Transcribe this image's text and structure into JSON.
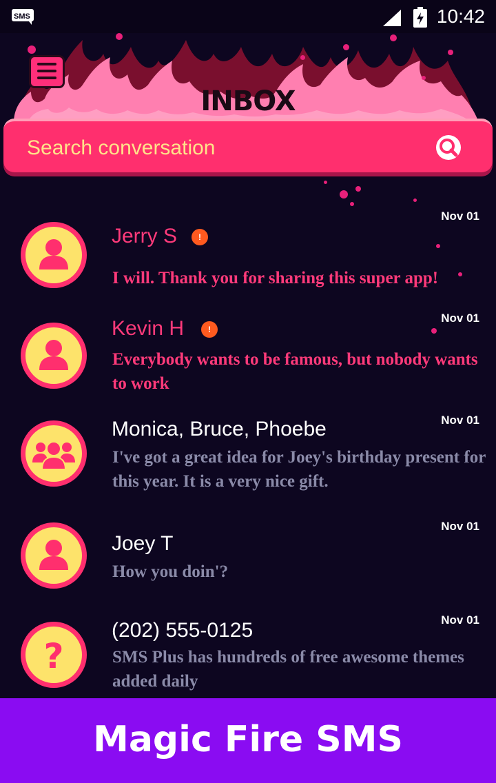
{
  "status_bar": {
    "time": "10:42",
    "app_icon": "sms-plus-icon",
    "signal_icon": "signal-icon",
    "battery_icon": "battery-charging-icon"
  },
  "header": {
    "title": "INBOX",
    "menu_icon": "hamburger-menu-icon"
  },
  "search": {
    "placeholder": "Search conversation",
    "icon": "search-icon"
  },
  "conversations": [
    {
      "name": "Jerry S",
      "snippet": "I will. Thank you for sharing this super app!",
      "date": "Nov 01",
      "unread": true,
      "badge": "!",
      "avatar": "person-icon"
    },
    {
      "name": "Kevin H",
      "snippet": "Everybody wants to be famous, but nobody wants to work",
      "date": "Nov 01",
      "unread": true,
      "badge": "!",
      "avatar": "person-icon"
    },
    {
      "name": "Monica, Bruce, Phoebe",
      "snippet": "I've got a great idea for Joey's birthday present for this year. It is a very nice gift.",
      "date": "Nov 01",
      "unread": false,
      "avatar": "group-icon"
    },
    {
      "name": "Joey T",
      "snippet": "How you doin'?",
      "date": "Nov 01",
      "unread": false,
      "avatar": "person-icon"
    },
    {
      "name": "(202) 555-0125",
      "snippet": "SMS Plus has hundreds of free awesome themes added daily",
      "date": "Nov 01",
      "unread": false,
      "avatar": "unknown-contact-icon"
    }
  ],
  "banner": {
    "text": "Magic Fire SMS"
  },
  "colors": {
    "background": "#0d0620",
    "accent": "#ff2f6e",
    "avatar_fill": "#fde36b",
    "banner": "#8a0cf2",
    "unread_text": "#ff3a7a",
    "read_snippet": "#8a8aa8"
  }
}
